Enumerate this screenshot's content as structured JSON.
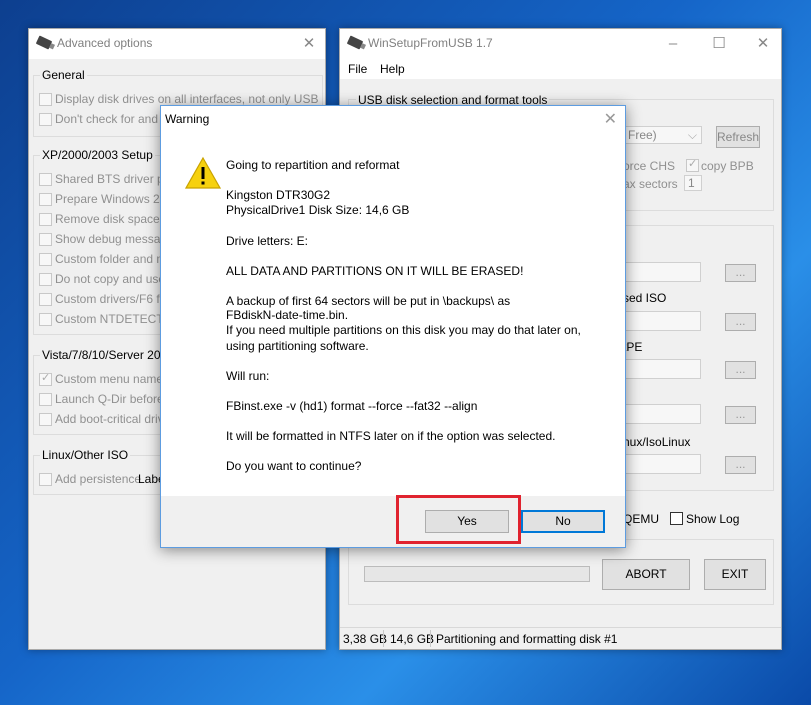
{
  "advanced_options": {
    "title": "Advanced options",
    "close_glyph": "✕",
    "general": {
      "label": "General",
      "items": [
        {
          "label": "Display disk drives on all interfaces, not only USB",
          "checked": false
        },
        {
          "label": "Don't check for and in",
          "checked": false
        }
      ]
    },
    "xp": {
      "label": "XP/2000/2003 Setup",
      "items": [
        {
          "label": "Shared BTS driver pac",
          "checked": false
        },
        {
          "label": "Prepare Windows 200",
          "checked": false
        },
        {
          "label": "Remove disk space re",
          "checked": false
        },
        {
          "label": "Show debug message",
          "checked": false
        },
        {
          "label": "Custom folder and me",
          "checked": false
        },
        {
          "label": "Do not copy and use D",
          "checked": false
        },
        {
          "label": "Custom drivers/F6 flop",
          "checked": false
        },
        {
          "label": "Custom NTDETECT.C",
          "checked": false
        }
      ]
    },
    "vista": {
      "label": "Vista/7/8/10/Server 200",
      "items": [
        {
          "label": "Custom menu names fo",
          "checked": true
        },
        {
          "label": "Launch Q-Dir before S",
          "checked": false
        },
        {
          "label": "Add boot-critical drivers",
          "checked": false
        }
      ]
    },
    "linux": {
      "label": "Linux/Other ISO",
      "items": [
        {
          "label": "Add persistence",
          "checked": false
        }
      ],
      "extra_label": "Labe"
    }
  },
  "main_window": {
    "title": "WinSetupFromUSB 1.7",
    "menu": [
      "File",
      "Help"
    ],
    "usb_group_label": "USB disk selection and format tools",
    "disk_select_value": "Free)",
    "refresh_label": "Refresh",
    "force_chs_label": "orce CHS",
    "copy_bpb_label": "copy BPB",
    "max_sectors_label": "ax sectors",
    "max_sectors_value": "1",
    "partial_labels": {
      "based_iso": "sed ISO",
      "pe": "tPE",
      "isolinux": "nux/IsoLinux"
    },
    "browse_label": "...",
    "qemu_label": "QEMU",
    "show_log_label": "Show Log",
    "abort_label": "ABORT",
    "exit_label": "EXIT",
    "status": {
      "size1": "3,38 GB",
      "size2": "14,6 GB",
      "message": "Partitioning and formatting disk #1"
    }
  },
  "dialog": {
    "title": "Warning",
    "close_glyph": "✕",
    "lines": [
      "Going to repartition and reformat",
      "Kingston DTR30G2",
      "PhysicalDrive1   Disk Size: 14,6 GB",
      "Drive letters:  E:",
      "ALL DATA AND PARTITIONS ON IT WILL BE ERASED!",
      "A backup of first 64 sectors will be put in \\backups\\ as",
      "FBdiskN-date-time.bin.",
      "If you need multiple partitions on this disk you may do that later on,",
      "using partitioning software.",
      "Will run:",
      "FBinst.exe -v (hd1) format --force  --fat32 --align",
      "It will be formatted in NTFS later on if the option was selected.",
      "Do you want to continue?"
    ],
    "yes_label": "Yes",
    "no_label": "No"
  },
  "colors": {
    "highlight": "#e0232f",
    "dialog_border": "#5d9ce0",
    "default_button_border": "#0078d7"
  }
}
